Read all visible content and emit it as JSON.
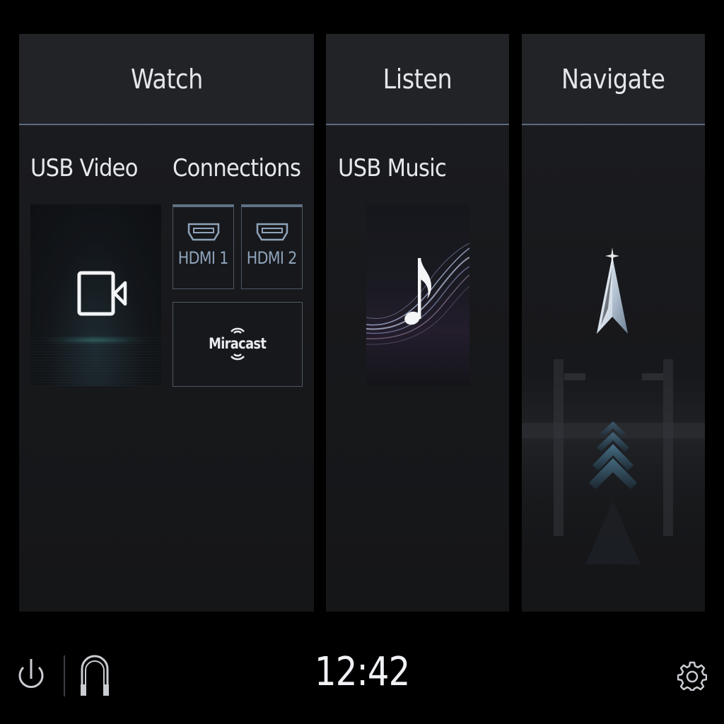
{
  "panels": {
    "watch": {
      "title": "Watch",
      "usb_video_label": "USB Video",
      "connections_label": "Connections",
      "hdmi1_label": "HDMI 1",
      "hdmi2_label": "HDMI 2",
      "miracast_label": "Miracast"
    },
    "listen": {
      "title": "Listen",
      "usb_music_label": "USB Music"
    },
    "navigate": {
      "title": "Navigate"
    }
  },
  "status_bar": {
    "time": "12:42"
  },
  "icons": {
    "power": "power-icon",
    "headphones": "headphones-icon",
    "settings": "gear-icon",
    "video_camera": "video-camera-icon",
    "hdmi": "hdmi-port-icon",
    "miracast": "miracast-icon",
    "music_note": "music-note-icon",
    "navigation_arrow": "navigation-arrow-icon"
  },
  "colors": {
    "accent": "#5f7285",
    "label_blue": "#8ea3ba",
    "panel_bg": "#1c1d21",
    "background": "#000000"
  }
}
